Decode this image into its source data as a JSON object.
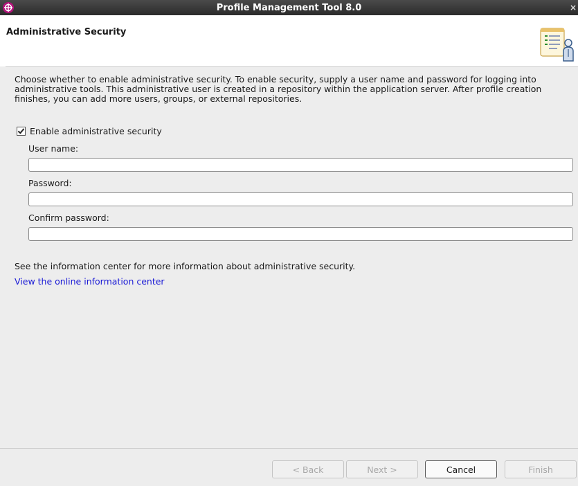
{
  "window": {
    "title": "Profile Management Tool 8.0",
    "close_glyph": "×",
    "app_icon": "eclipse-crosshair-icon",
    "accent_color": "#b3127a"
  },
  "header": {
    "heading": "Administrative Security",
    "icon": "wizard-checklist-user-icon"
  },
  "main": {
    "description": "Choose whether to enable administrative security. To enable security, supply a user name and password for logging into administrative tools. This administrative user is created in a repository within the application server. After profile creation finishes, you can add more users, groups, or external repositories.",
    "enable_checkbox": {
      "label": "Enable administrative security",
      "checked": true
    },
    "fields": {
      "username": {
        "label": "User name:",
        "value": ""
      },
      "password": {
        "label": "Password:",
        "value": ""
      },
      "confirm": {
        "label": "Confirm password:",
        "value": ""
      }
    },
    "info_text": "See the information center for more information about administrative security.",
    "info_link": "View the online information center",
    "link_color": "#1a1ad6"
  },
  "footer": {
    "back": {
      "label": "< Back",
      "enabled": false
    },
    "next": {
      "label": "Next >",
      "enabled": false
    },
    "cancel": {
      "label": "Cancel",
      "enabled": true
    },
    "finish": {
      "label": "Finish",
      "enabled": false
    }
  }
}
